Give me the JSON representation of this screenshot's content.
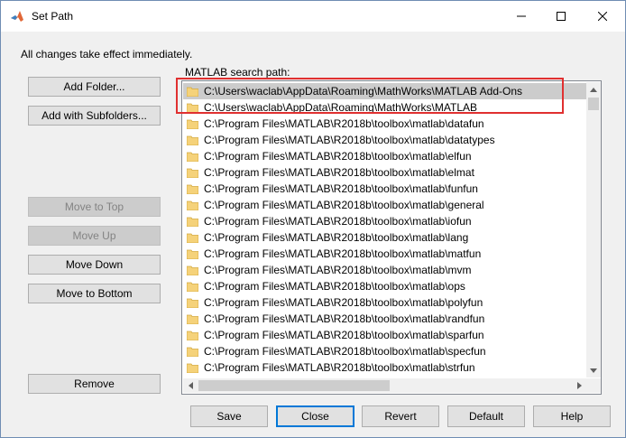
{
  "window": {
    "title": "Set Path",
    "info_text": "All changes take effect immediately.",
    "path_label": "MATLAB search path:"
  },
  "left_buttons": {
    "add_folder": "Add Folder...",
    "add_with_subfolders": "Add with Subfolders...",
    "move_to_top": "Move to Top",
    "move_up": "Move Up",
    "move_down": "Move Down",
    "move_to_bottom": "Move to Bottom",
    "remove": "Remove"
  },
  "paths": [
    "C:\\Users\\waclab\\AppData\\Roaming\\MathWorks\\MATLAB Add-Ons",
    "C:\\Users\\waclab\\AppData\\Roaming\\MathWorks\\MATLAB",
    "C:\\Program Files\\MATLAB\\R2018b\\toolbox\\matlab\\datafun",
    "C:\\Program Files\\MATLAB\\R2018b\\toolbox\\matlab\\datatypes",
    "C:\\Program Files\\MATLAB\\R2018b\\toolbox\\matlab\\elfun",
    "C:\\Program Files\\MATLAB\\R2018b\\toolbox\\matlab\\elmat",
    "C:\\Program Files\\MATLAB\\R2018b\\toolbox\\matlab\\funfun",
    "C:\\Program Files\\MATLAB\\R2018b\\toolbox\\matlab\\general",
    "C:\\Program Files\\MATLAB\\R2018b\\toolbox\\matlab\\iofun",
    "C:\\Program Files\\MATLAB\\R2018b\\toolbox\\matlab\\lang",
    "C:\\Program Files\\MATLAB\\R2018b\\toolbox\\matlab\\matfun",
    "C:\\Program Files\\MATLAB\\R2018b\\toolbox\\matlab\\mvm",
    "C:\\Program Files\\MATLAB\\R2018b\\toolbox\\matlab\\ops",
    "C:\\Program Files\\MATLAB\\R2018b\\toolbox\\matlab\\polyfun",
    "C:\\Program Files\\MATLAB\\R2018b\\toolbox\\matlab\\randfun",
    "C:\\Program Files\\MATLAB\\R2018b\\toolbox\\matlab\\sparfun",
    "C:\\Program Files\\MATLAB\\R2018b\\toolbox\\matlab\\specfun",
    "C:\\Program Files\\MATLAB\\R2018b\\toolbox\\matlab\\strfun"
  ],
  "selected_index": 0,
  "bottom_buttons": {
    "save": "Save",
    "close": "Close",
    "revert": "Revert",
    "default": "Default",
    "help": "Help"
  },
  "colors": {
    "highlight_box": "#e03030",
    "selected_row": "#cccccc",
    "folder": "#f5d27a"
  },
  "icons": {
    "app": "matlab-logo-icon",
    "folder": "folder-icon"
  }
}
